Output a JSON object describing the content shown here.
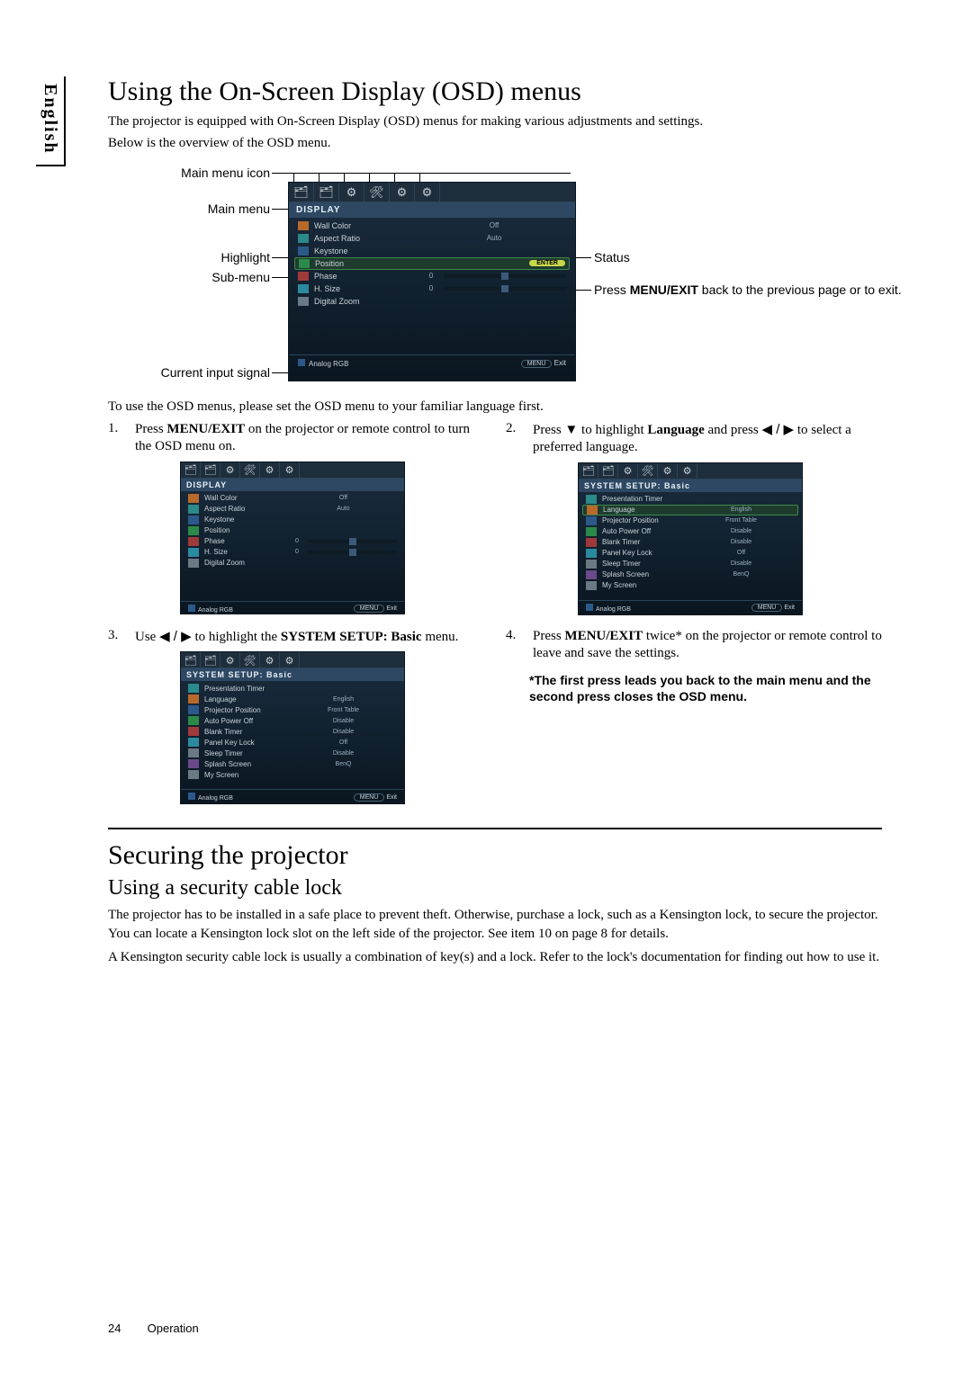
{
  "sideTab": "English",
  "h1_osd": "Using the On-Screen Display (OSD) menus",
  "intro1": "The projector is equipped with On-Screen Display (OSD) menus for making various adjustments and settings.",
  "intro2": "Below is the overview of the OSD menu.",
  "annotations": {
    "mainMenuIcon": "Main menu icon",
    "mainMenu": "Main menu",
    "highlight": "Highlight",
    "subMenu": "Sub-menu",
    "currentInput": "Current input signal",
    "status": "Status",
    "pressMenuExit_pre": "Press ",
    "pressMenuExit_bold": "MENU/EXIT",
    "pressMenuExit_post": " back to the previous page or to exit."
  },
  "osd_display": {
    "title": "DISPLAY",
    "rows": [
      {
        "label": "Wall Color",
        "value": "Off"
      },
      {
        "label": "Aspect Ratio",
        "value": "Auto"
      },
      {
        "label": "Keystone",
        "value": ""
      },
      {
        "label": "Position",
        "value": "",
        "enter": true,
        "hl": true
      },
      {
        "label": "Phase",
        "value": "0",
        "slider": true
      },
      {
        "label": "H. Size",
        "value": "0",
        "slider": true
      },
      {
        "label": "Digital Zoom",
        "value": ""
      }
    ],
    "footerLeft": "Analog RGB",
    "footerBtn": "MENU",
    "footerRight": "Exit"
  },
  "afterDiagram": "To use the OSD menus, please set the OSD menu to your familiar language first.",
  "steps": {
    "s1_num": "1.",
    "s1_pre": "Press ",
    "s1_bold": "MENU/EXIT",
    "s1_post": " on the projector or remote control to turn the OSD menu on.",
    "s2_num": "2.",
    "s2_a": "Press ",
    "s2_b": " to highlight ",
    "s2_bold": "Language",
    "s2_c": " and press ",
    "s2_d": " to select a preferred language.",
    "s3_num": "3.",
    "s3_a": "Use ",
    "s3_b": " to highlight the ",
    "s3_bold": "SYSTEM SETUP: Basic",
    "s3_c": " menu.",
    "s4_num": "4.",
    "s4_a": "Press ",
    "s4_bold": "MENU/EXIT",
    "s4_b": " twice* on the projector or remote control to leave and save the settings.",
    "s4_note": "*The first press leads you back to the main menu and the second press closes the OSD menu."
  },
  "osd_display_small": {
    "title": "DISPLAY",
    "rows": [
      {
        "label": "Wall Color",
        "value": "Off"
      },
      {
        "label": "Aspect Ratio",
        "value": "Auto"
      },
      {
        "label": "Keystone",
        "value": ""
      },
      {
        "label": "Position",
        "value": ""
      },
      {
        "label": "Phase",
        "value": "0",
        "slider": true
      },
      {
        "label": "H. Size",
        "value": "0",
        "slider": true
      },
      {
        "label": "Digital Zoom",
        "value": ""
      }
    ],
    "footerLeft": "Analog RGB",
    "footerBtn": "MENU",
    "footerRight": "Exit"
  },
  "osd_system": {
    "title": "SYSTEM SETUP: Basic",
    "rows": [
      {
        "label": "Presentation Timer",
        "value": ""
      },
      {
        "label": "Language",
        "value": "English"
      },
      {
        "label": "Projector Position",
        "value": "Front Table"
      },
      {
        "label": "Auto Power Off",
        "value": "Disable"
      },
      {
        "label": "Blank Timer",
        "value": "Disable"
      },
      {
        "label": "Panel Key Lock",
        "value": "Off"
      },
      {
        "label": "Sleep Timer",
        "value": "Disable"
      },
      {
        "label": "Splash Screen",
        "value": "BenQ"
      },
      {
        "label": "My Screen",
        "value": ""
      }
    ],
    "footerLeft": "Analog RGB",
    "footerBtn": "MENU",
    "footerRight": "Exit"
  },
  "osd_system_hl": {
    "title": "SYSTEM SETUP: Basic",
    "rows": [
      {
        "label": "Presentation Timer",
        "value": ""
      },
      {
        "label": "Language",
        "value": "English",
        "hl": true
      },
      {
        "label": "Projector Position",
        "value": "Front Table"
      },
      {
        "label": "Auto Power Off",
        "value": "Disable"
      },
      {
        "label": "Blank Timer",
        "value": "Disable"
      },
      {
        "label": "Panel Key Lock",
        "value": "Off"
      },
      {
        "label": "Sleep Timer",
        "value": "Disable"
      },
      {
        "label": "Splash Screen",
        "value": "BenQ"
      },
      {
        "label": "My Screen",
        "value": ""
      }
    ],
    "footerLeft": "Analog RGB",
    "footerBtn": "MENU",
    "footerRight": "Exit"
  },
  "arrows": {
    "down": "▼",
    "left": "◀",
    "right": "▶",
    "slash": " / "
  },
  "tab_icons": [
    "🗂",
    "🗂",
    "⚙",
    "🛠",
    "⚙",
    "⚙"
  ],
  "h1_secure": "Securing the projector",
  "h2_cable": "Using a security cable lock",
  "secure_p1": "The projector has to be installed in a safe place to prevent theft. Otherwise, purchase a lock, such as a Kensington lock, to secure the projector. You can locate a Kensington lock slot on the left side of the projector. See item 10 on page 8 for details.",
  "secure_p2": "A Kensington security cable lock is usually a combination of key(s) and a lock. Refer to the lock's documentation for finding out how to use it.",
  "footer": {
    "page": "24",
    "section": "Operation"
  }
}
